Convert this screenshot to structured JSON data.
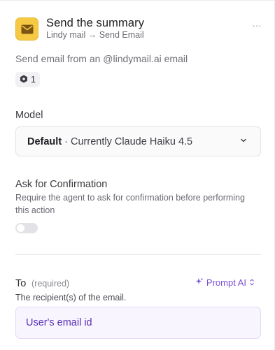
{
  "header": {
    "title": "Send the summary",
    "subtitle": "Lindy mail → Send Email",
    "more_label": "···",
    "icon": "envelope-icon",
    "icon_color": "#f6c945"
  },
  "description": "Send email from an @lindymail.ai email",
  "badge": {
    "icon": "hexagon-icon",
    "count": "1"
  },
  "model": {
    "label": "Model",
    "selected_bold": "Default",
    "selected_rest": "· Currently Claude Haiku 4.5"
  },
  "confirmation": {
    "label": "Ask for Confirmation",
    "help": "Require the agent to ask for confirmation before performing this action",
    "enabled": false
  },
  "to_field": {
    "label": "To",
    "required": "(required)",
    "prompt_ai_label": "Prompt AI",
    "help": "The recipient(s) of the email.",
    "value": "User's email id"
  },
  "colors": {
    "accent": "#7a4fd6",
    "input_bg": "#f8f5ff"
  }
}
